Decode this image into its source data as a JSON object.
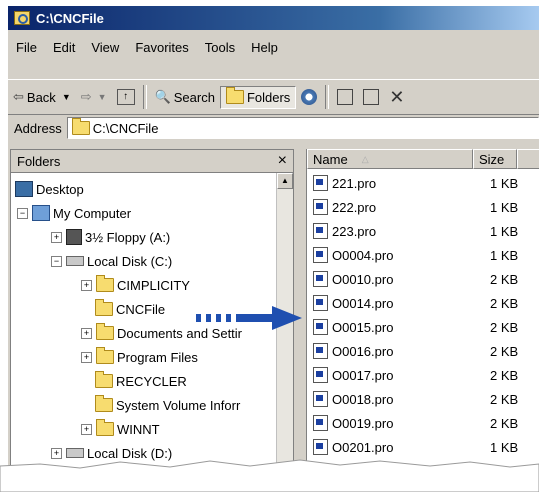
{
  "window": {
    "title": "C:\\CNCFile"
  },
  "menu": [
    "File",
    "Edit",
    "View",
    "Favorites",
    "Tools",
    "Help"
  ],
  "toolbar": {
    "back": "Back",
    "search": "Search",
    "folders": "Folders"
  },
  "address": {
    "label": "Address",
    "value": "C:\\CNCFile"
  },
  "folders_pane": {
    "title": "Folders",
    "close": "×"
  },
  "tree": [
    {
      "label": "Desktop",
      "icon": "desktop-icon"
    },
    {
      "label": "My Computer",
      "icon": "computer-icon"
    },
    {
      "label": "3½ Floppy (A:)",
      "icon": "floppy-icon"
    },
    {
      "label": "Local Disk (C:)",
      "icon": "drive-icon"
    },
    {
      "label": "CIMPLICITY",
      "icon": "folder-icon"
    },
    {
      "label": "CNCFile",
      "icon": "folder-open-icon"
    },
    {
      "label": "Documents and Settir",
      "icon": "folder-icon"
    },
    {
      "label": "Program Files",
      "icon": "folder-icon"
    },
    {
      "label": "RECYCLER",
      "icon": "folder-icon"
    },
    {
      "label": "System Volume Inforr",
      "icon": "folder-icon"
    },
    {
      "label": "WINNT",
      "icon": "folder-icon"
    },
    {
      "label": "Local Disk (D:)",
      "icon": "drive-icon"
    }
  ],
  "columns": {
    "name": "Name",
    "size": "Size"
  },
  "files": [
    {
      "name": "221.pro",
      "size": "1 KB"
    },
    {
      "name": "222.pro",
      "size": "1 KB"
    },
    {
      "name": "223.pro",
      "size": "1 KB"
    },
    {
      "name": "O0004.pro",
      "size": "1 KB"
    },
    {
      "name": "O0010.pro",
      "size": "2 KB"
    },
    {
      "name": "O0014.pro",
      "size": "2 KB"
    },
    {
      "name": "O0015.pro",
      "size": "2 KB"
    },
    {
      "name": "O0016.pro",
      "size": "2 KB"
    },
    {
      "name": "O0017.pro",
      "size": "2 KB"
    },
    {
      "name": "O0018.pro",
      "size": "2 KB"
    },
    {
      "name": "O0019.pro",
      "size": "2 KB"
    },
    {
      "name": "O0201.pro",
      "size": "1 KB"
    }
  ],
  "colors": {
    "title_start": "#0a246a",
    "arrow": "#1f4fb0"
  }
}
